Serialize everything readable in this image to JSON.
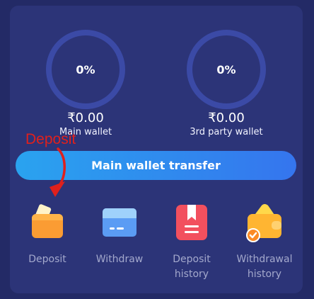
{
  "wallets": {
    "main": {
      "percent": "0%",
      "amount": "₹0.00",
      "label": "Main wallet"
    },
    "third_party": {
      "percent": "0%",
      "amount": "₹0.00",
      "label": "3rd party wallet"
    }
  },
  "transfer_button": {
    "label": "Main wallet transfer"
  },
  "annotation": {
    "text": "Deposit"
  },
  "actions": [
    {
      "label": "Deposit",
      "icon": "wallet-icon"
    },
    {
      "label": "Withdraw",
      "icon": "credit-card-icon"
    },
    {
      "label": "Deposit\nhistory",
      "icon": "bookmark-document-icon"
    },
    {
      "label": "Withdrawal\nhistory",
      "icon": "wallet-check-icon"
    }
  ],
  "colors": {
    "background": "#232a66",
    "card": "#2c3478",
    "ring": "#3b4aa6",
    "button_gradient_start": "#2aa3ef",
    "button_gradient_end": "#3575ee",
    "annotation_red": "#e0201c"
  }
}
